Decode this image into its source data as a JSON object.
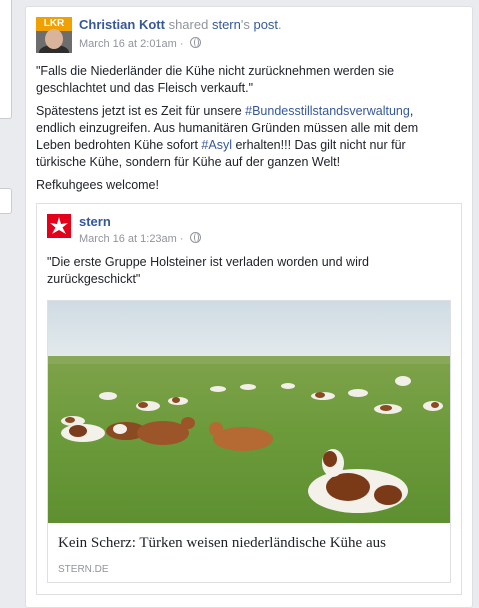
{
  "post": {
    "author": "Christian Kott",
    "action": "shared",
    "source_name": "stern",
    "source_suffix": "'s",
    "object": "post",
    "period": ".",
    "timestamp": "March 16 at 2:01am",
    "separator": "·",
    "avatar_badge": "LKR",
    "text": {
      "p1": "\"Falls die Niederländer die Kühe nicht zurücknehmen werden sie geschlachtet und das Fleisch verkauft.\"",
      "p2_a": "Spätestens jetzt ist es Zeit für unsere ",
      "p2_tag1": "#Bundesstillstandsverwaltung",
      "p2_b": ", endlich einzugreifen. Aus humanitären Gründen müssen alle mit dem Leben bedrohten Kühe sofort ",
      "p2_tag2": "#Asyl",
      "p2_c": " erhalten!!! Das gilt nicht nur für türkische Kühe, sondern für Kühe auf der ganzen Welt!",
      "p3": "Refkuhgees welcome!"
    }
  },
  "shared_post": {
    "page_name": "stern",
    "timestamp": "March 16 at 1:23am",
    "separator": "·",
    "text": "\"Die erste Gruppe Holsteiner ist verladen worden und wird zurückgeschickt\"",
    "link_preview": {
      "title": "Kein Scherz: Türken weisen niederländische Kühe aus",
      "domain": "STERN.DE"
    }
  },
  "colors": {
    "link": "#365899",
    "muted": "#90949c",
    "stern_red": "#e2001a",
    "background": "#e9ebee"
  },
  "icons": {
    "privacy": "globe-icon",
    "stern_logo": "stern-star-logo"
  }
}
